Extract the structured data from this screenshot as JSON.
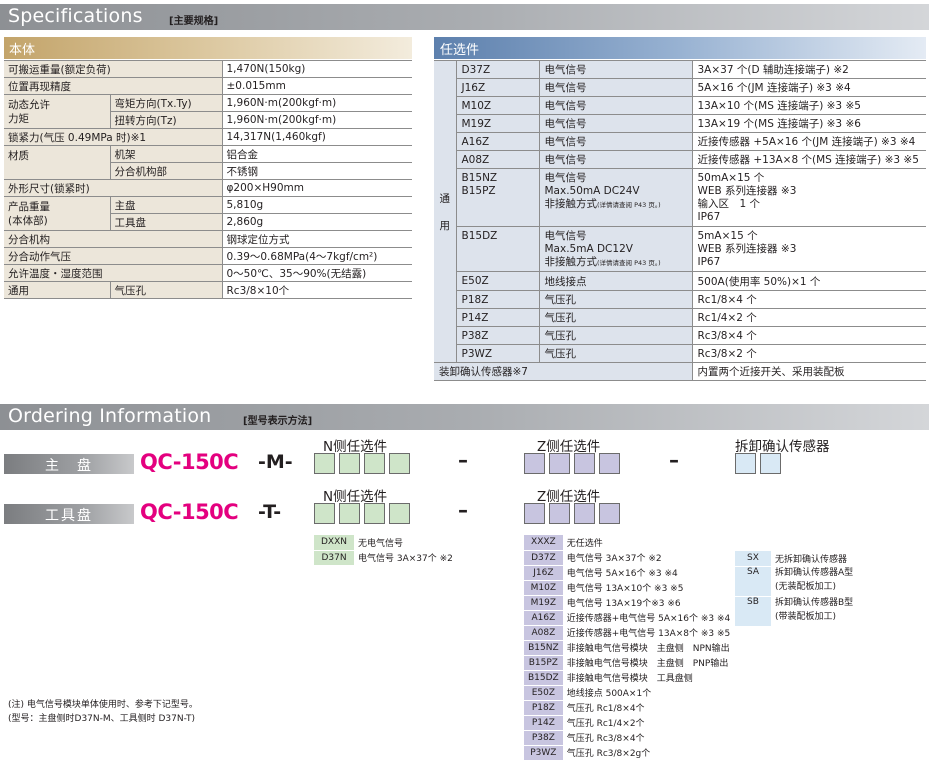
{
  "specs_header": {
    "title": "Specifications",
    "sub": "[主要规格]"
  },
  "body_bar": "本体",
  "options_bar": "任选件",
  "spec_rows": [
    {
      "label": "可搬运重量(额定负荷)",
      "sub": "",
      "value": "1,470N(150kg)"
    },
    {
      "label": "位置再现精度",
      "sub": "",
      "value": "±0.015mm"
    },
    {
      "label": "动态允许",
      "label2": "力矩",
      "sub": "弯矩方向(Tx.Ty)",
      "value": "1,960N·m(200kgf·m)"
    },
    {
      "label": "",
      "sub": "扭转方向(Tz)",
      "value": "1,960N·m(200kgf·m)"
    },
    {
      "label": "锁紧力(气压 0.49MPa 时)※1",
      "sub": "",
      "value": "14,317N(1,460kgf)"
    },
    {
      "label": "材质",
      "sub": "机架",
      "value": "铝合金"
    },
    {
      "label": "",
      "sub": "分合机构部",
      "value": "不锈钢"
    },
    {
      "label": "外形尺寸(锁紧时)",
      "sub": "",
      "value": "φ200×H90mm"
    },
    {
      "label": "产品重量",
      "label2": "(本体部)",
      "sub": "主盘",
      "value": "5,810g"
    },
    {
      "label": "",
      "sub": "工具盘",
      "value": "2,860g"
    },
    {
      "label": "分合机构",
      "sub": "",
      "value": "钢球定位方式"
    },
    {
      "label": "分合动作气压",
      "sub": "",
      "value": "0.39～0.68MPa(4～7kgf/cm²)"
    },
    {
      "label": "允许温度・湿度范围",
      "sub": "",
      "value": "0～50℃、35～90%(无结露)"
    },
    {
      "label": "通用",
      "sub": "气压孔",
      "value": "Rc3/8×10个"
    }
  ],
  "opt_side_label": [
    "通",
    "用"
  ],
  "option_rows": [
    {
      "code": "D37Z",
      "type": "电气信号",
      "spec": "3A×37 个(D 辅助连接端子) ※2"
    },
    {
      "code": "J16Z",
      "type": "电气信号",
      "spec": "5A×16 个(JM 连接端子) ※3 ※4"
    },
    {
      "code": "M10Z",
      "type": "电气信号",
      "spec": "13A×10 个(MS 连接端子) ※3 ※5"
    },
    {
      "code": "M19Z",
      "type": "电气信号",
      "spec": "13A×19 个(MS 连接端子) ※3 ※6"
    },
    {
      "code": "A16Z",
      "type": "电气信号",
      "spec": "近接传感器 +5A×16 个(JM 连接端子) ※3 ※4"
    },
    {
      "code": "A08Z",
      "type": "电气信号",
      "spec": "近接传感器 +13A×8 个(MS 连接端子) ※3 ※5"
    },
    {
      "code": "B15NZ",
      "code2": "B15PZ",
      "type": "电气信号",
      "type2": "Max.50mA DC24V",
      "type3": "非接触方式",
      "type3s": "(详情请查阅 P43 页。)",
      "spec": "50mA×15 个",
      "spec2": "WEB 系列连接器 ※3",
      "spec3": "输入区　1 个",
      "spec4": "IP67"
    },
    {
      "code": "B15DZ",
      "type": "电气信号",
      "type2": "Max.5mA DC12V",
      "type3": "非接触方式",
      "type3s": "(详情请查阅 P43 页。)",
      "spec": "5mA×15 个",
      "spec2": "WEB 系列连接器 ※3",
      "spec3": "IP67"
    },
    {
      "code": "E50Z",
      "type": "地线接点",
      "spec": "500A(使用率 50%)×1 个"
    },
    {
      "code": "P18Z",
      "type": "气压孔",
      "spec": "Rc1/8×4 个"
    },
    {
      "code": "P14Z",
      "type": "气压孔",
      "spec": "Rc1/4×2 个"
    },
    {
      "code": "P38Z",
      "type": "气压孔",
      "spec": "Rc3/8×4 个"
    },
    {
      "code": "P3WZ",
      "type": "气压孔",
      "spec": "Rc3/8×2 个"
    }
  ],
  "sensor_row": {
    "label": "装卸确认传感器※7",
    "value": "内置两个近接开关、采用装配板"
  },
  "ordering_header": {
    "title": "Ordering Information",
    "sub": "[型号表示方法]"
  },
  "group_headers": {
    "n_side": "N侧任选件",
    "z_side": "Z侧任选件",
    "sensor": "拆卸确认传感器"
  },
  "rows": [
    {
      "label": "主　盘",
      "model": "QC-150C",
      "suffix": "-M-"
    },
    {
      "label": "工具盘",
      "model": "QC-150C",
      "suffix": "-T-"
    }
  ],
  "dash": "–",
  "n_codes": [
    {
      "code": "DXXN",
      "desc": "无电气信号"
    },
    {
      "code": "D37N",
      "desc": "电气信号 3A×37个 ※2"
    }
  ],
  "z_codes": [
    {
      "code": "XXXZ",
      "desc": "无任选件",
      "small": false
    },
    {
      "code": "D37Z",
      "desc": "电气信号 3A×37个 ※2",
      "small": false
    },
    {
      "code": "J16Z",
      "desc": "电气信号 5A×16个 ※3 ※4",
      "small": false
    },
    {
      "code": "M10Z",
      "desc": "电气信号 13A×10个 ※3 ※5",
      "small": false
    },
    {
      "code": "M19Z",
      "desc": "电气信号 13A×19个※3 ※6",
      "small": false
    },
    {
      "code": "A16Z",
      "desc": "近接传感器+电气信号 5A×16个 ※3 ※4",
      "small": true
    },
    {
      "code": "A08Z",
      "desc": "近接传感器+电气信号 13A×8个 ※3 ※5",
      "small": true
    },
    {
      "code": "B15NZ",
      "desc": "非接触电气信号模块　主盘侧　NPN输出",
      "small": true
    },
    {
      "code": "B15PZ",
      "desc": "非接触电气信号模块　主盘侧　PNP输出",
      "small": true
    },
    {
      "code": "B15DZ",
      "desc": "非接触电气信号模块　工具盘侧",
      "small": true
    },
    {
      "code": "E50Z",
      "desc": "地线接点 500A×1个",
      "small": false
    },
    {
      "code": "P18Z",
      "desc": "气压孔 Rc1/8×4个",
      "small": false
    },
    {
      "code": "P14Z",
      "desc": "气压孔 Rc1/4×2个",
      "small": false
    },
    {
      "code": "P38Z",
      "desc": "气压孔 Rc3/8×4个",
      "small": false
    },
    {
      "code": "P3WZ",
      "desc": "气压孔 Rc3/8×2g个",
      "small": false
    }
  ],
  "s_codes": [
    {
      "code": "SX",
      "desc": "无拆卸确认传感器",
      "desc2": ""
    },
    {
      "code": "SA",
      "desc": "拆卸确认传感器A型",
      "desc2": "(无装配板加工)"
    },
    {
      "code": "SB",
      "desc": "拆卸确认传感器B型",
      "desc2": "(带装配板加工)"
    }
  ],
  "notes": [
    "(注) 电气信号模块单体使用时、参考下记型号。",
    "(型号：主盘侧时D37N-M、工具侧时 D37N-T)"
  ],
  "colors": {
    "accent": "#e4007f",
    "n_box": "#cfe5c9",
    "z_box": "#c8c5e0",
    "s_box": "#d9e9f5"
  }
}
